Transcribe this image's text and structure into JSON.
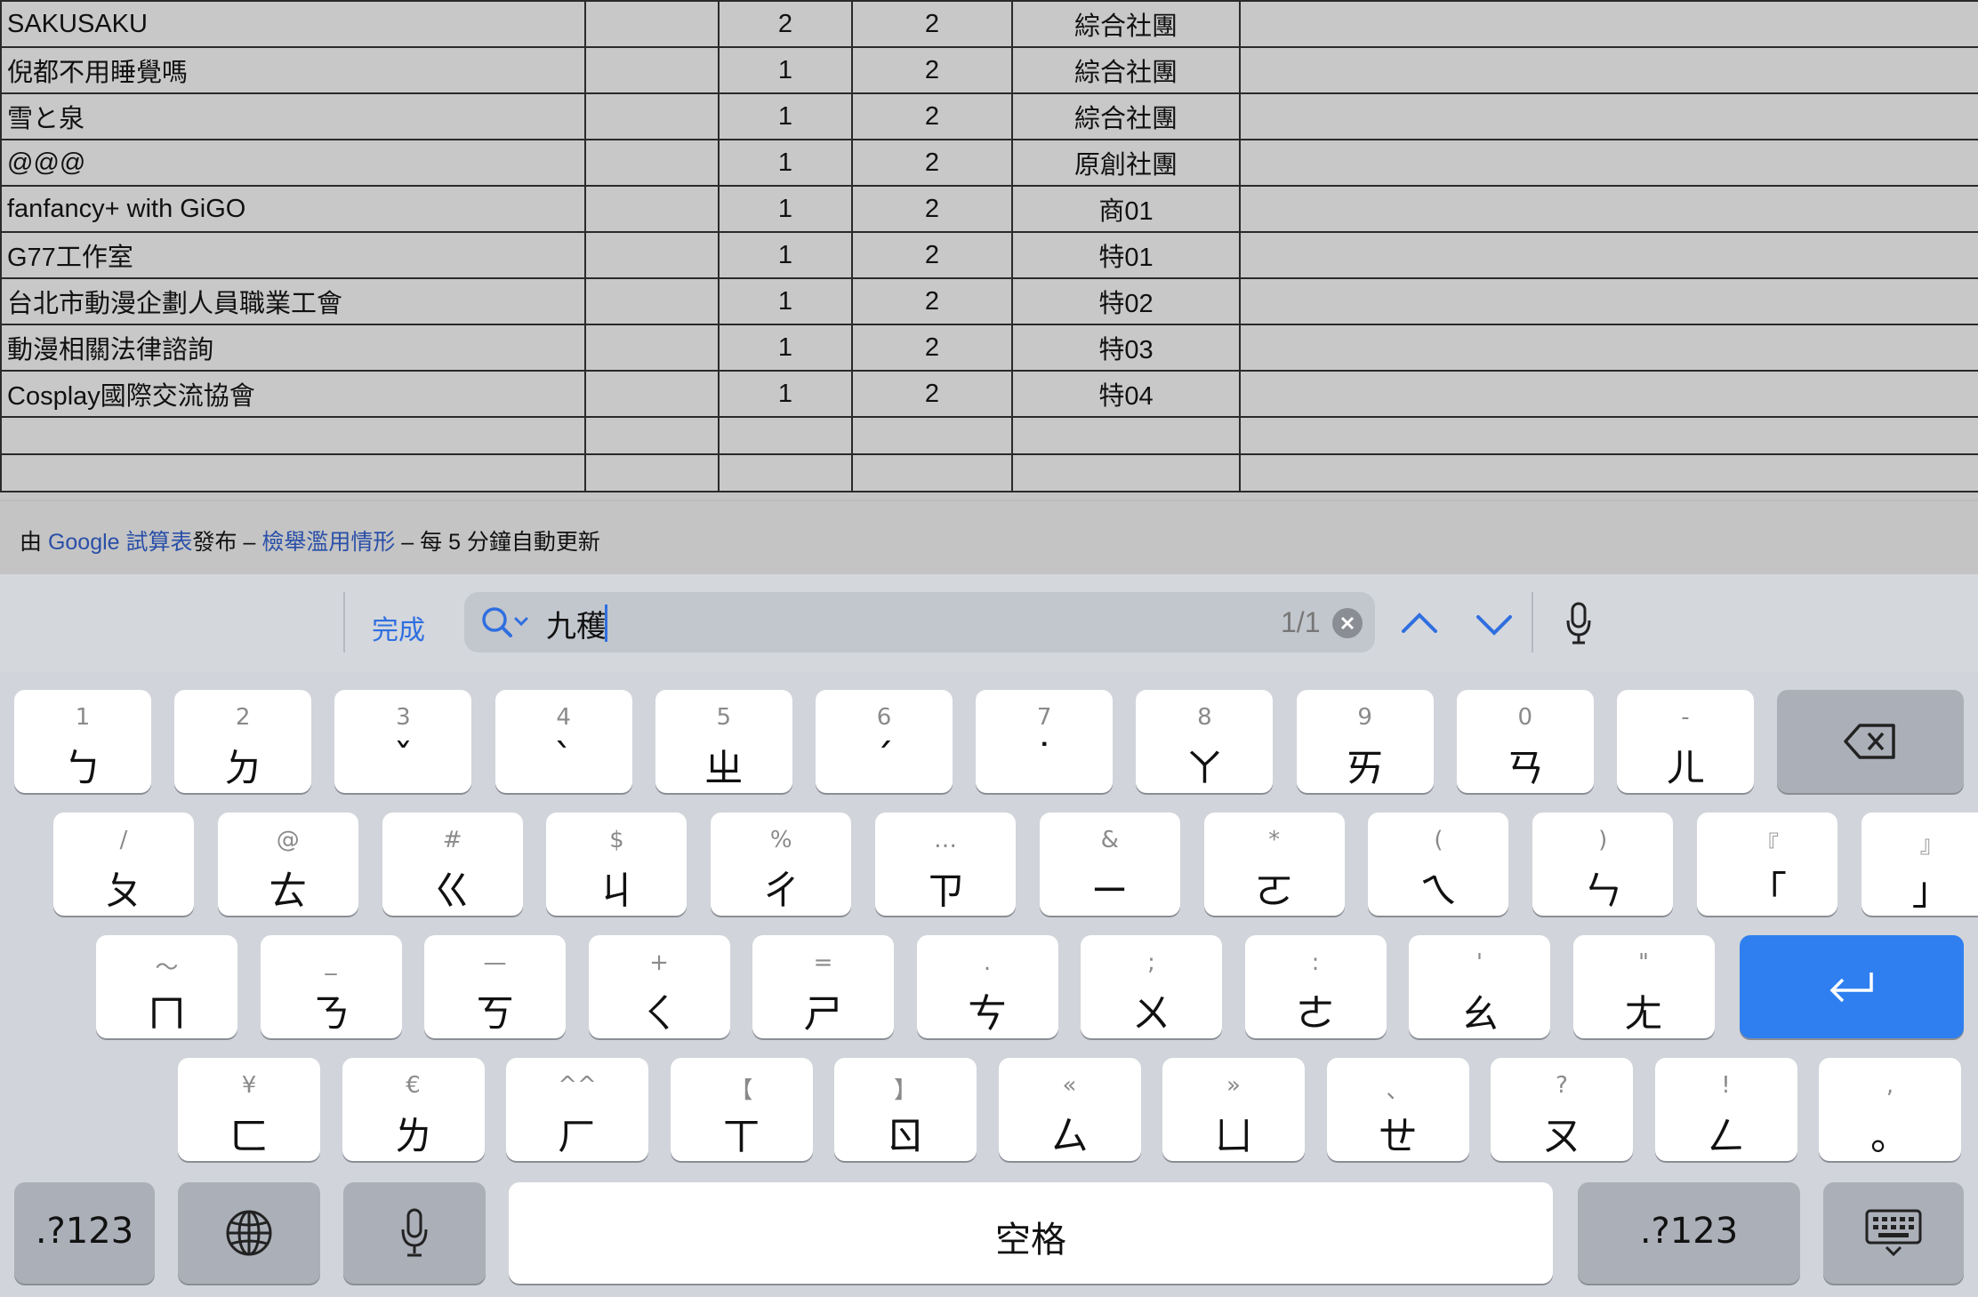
{
  "table": {
    "rows": [
      {
        "name": "SAKUSAKU",
        "b": "",
        "c": "2",
        "d": "2",
        "e": "綜合社團",
        "f": ""
      },
      {
        "name": "倪都不用睡覺嗎",
        "b": "",
        "c": "1",
        "d": "2",
        "e": "綜合社團",
        "f": ""
      },
      {
        "name": "雪と泉",
        "b": "",
        "c": "1",
        "d": "2",
        "e": "綜合社團",
        "f": ""
      },
      {
        "name": "@@@",
        "b": "",
        "c": "1",
        "d": "2",
        "e": "原創社團",
        "f": ""
      },
      {
        "name": "fanfancy+ with GiGO",
        "b": "",
        "c": "1",
        "d": "2",
        "e": "商01",
        "f": ""
      },
      {
        "name": "G77工作室",
        "b": "",
        "c": "1",
        "d": "2",
        "e": "特01",
        "f": ""
      },
      {
        "name": "台北市動漫企劃人員職業工會",
        "b": "",
        "c": "1",
        "d": "2",
        "e": "特02",
        "f": ""
      },
      {
        "name": "動漫相關法律諮詢",
        "b": "",
        "c": "1",
        "d": "2",
        "e": "特03",
        "f": ""
      },
      {
        "name": "Cosplay國際交流協會",
        "b": "",
        "c": "1",
        "d": "2",
        "e": "特04",
        "f": ""
      }
    ]
  },
  "footer": {
    "prefix": "由 ",
    "google_link": "Google 試算表",
    "published": "發布 – ",
    "report_link": "檢舉濫用情形",
    "suffix": " – 每 5 分鐘自動更新"
  },
  "findbar": {
    "done_label": "完成",
    "search_value": "九穫",
    "match_count": "1/1"
  },
  "keyboard": {
    "row1": [
      {
        "top": "1",
        "main": "ㄅ"
      },
      {
        "top": "2",
        "main": "ㄉ"
      },
      {
        "top": "3",
        "main": "ˇ"
      },
      {
        "top": "4",
        "main": "ˋ"
      },
      {
        "top": "5",
        "main": "ㄓ"
      },
      {
        "top": "6",
        "main": "ˊ"
      },
      {
        "top": "7",
        "main": "˙"
      },
      {
        "top": "8",
        "main": "ㄚ"
      },
      {
        "top": "9",
        "main": "ㄞ"
      },
      {
        "top": "0",
        "main": "ㄢ"
      },
      {
        "top": "-",
        "main": "ㄦ"
      }
    ],
    "row2": [
      {
        "top": "/",
        "main": "ㄆ"
      },
      {
        "top": "@",
        "main": "ㄊ"
      },
      {
        "top": "#",
        "main": "ㄍ"
      },
      {
        "top": "$",
        "main": "ㄐ"
      },
      {
        "top": "%",
        "main": "ㄔ"
      },
      {
        "top": "…",
        "main": "ㄗ"
      },
      {
        "top": "&",
        "main": "ㄧ"
      },
      {
        "top": "*",
        "main": "ㄛ"
      },
      {
        "top": "(",
        "main": "ㄟ"
      },
      {
        "top": ")",
        "main": "ㄣ"
      },
      {
        "top": "『",
        "main": "「"
      },
      {
        "top": "』",
        "main": "」"
      }
    ],
    "row3": [
      {
        "top": "～",
        "main": "ㄇ"
      },
      {
        "top": "_",
        "main": "ㄋ"
      },
      {
        "top": "—",
        "main": "ㄎ"
      },
      {
        "top": "+",
        "main": "ㄑ"
      },
      {
        "top": "=",
        "main": "ㄕ"
      },
      {
        "top": ".",
        "main": "ㄘ"
      },
      {
        "top": ";",
        "main": "ㄨ"
      },
      {
        "top": ":",
        "main": "ㄜ"
      },
      {
        "top": "'",
        "main": "ㄠ"
      },
      {
        "top": "\"",
        "main": "ㄤ"
      }
    ],
    "row4": [
      {
        "top": "¥",
        "main": "ㄈ"
      },
      {
        "top": "€",
        "main": "ㄌ"
      },
      {
        "top": "^^",
        "main": "ㄏ"
      },
      {
        "top": "【",
        "main": "ㄒ"
      },
      {
        "top": "】",
        "main": "ㄖ"
      },
      {
        "top": "«",
        "main": "ㄙ"
      },
      {
        "top": "»",
        "main": "ㄩ"
      },
      {
        "top": "、",
        "main": "ㄝ"
      },
      {
        "top": "?",
        "main": "ㄡ"
      },
      {
        "top": "!",
        "main": "ㄥ"
      },
      {
        "top": ",",
        "main": "。"
      }
    ],
    "numbers_label": ".?123",
    "space_label": "空格",
    "numbers_label_right": ".?123"
  }
}
